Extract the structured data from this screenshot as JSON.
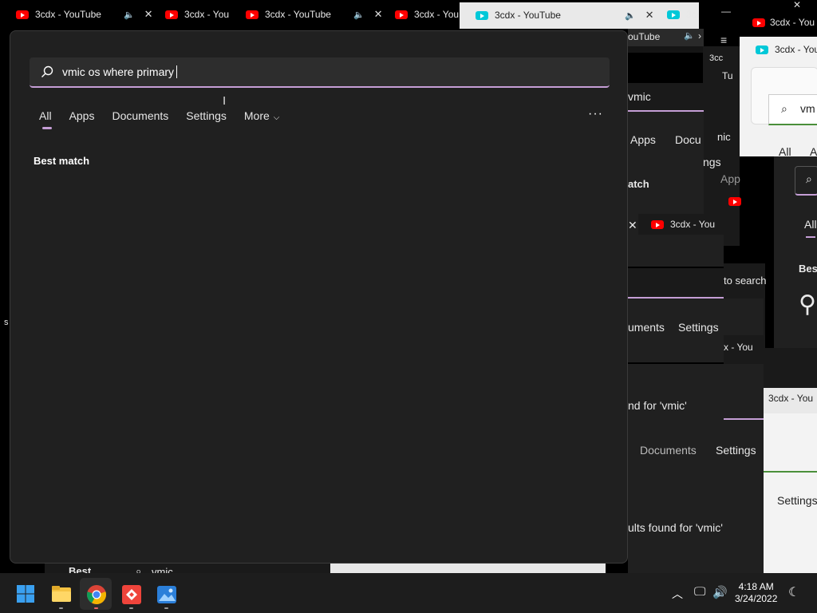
{
  "browser_tabs": [
    {
      "title": "3cdx - YouTube"
    },
    {
      "title": "3cdx - You"
    },
    {
      "title": "3cdx - YouTube"
    },
    {
      "title": "3cdx - You"
    },
    {
      "title": "3cdx - YouTube"
    },
    {
      "title": "3cc"
    }
  ],
  "ghost": {
    "top_tab_1": "3cdx - You",
    "top_tab_2": "3cdx - You",
    "yt_label": "ouTube",
    "tu_label": "3cc",
    "tu_label2": "Tu",
    "search_partial": "vmic",
    "search_partial_2": "vm",
    "apps": "Apps",
    "docu": "Docu",
    "ngs": "ngs",
    "all": "All",
    "a": "A",
    "app": "App",
    "atch": "atch",
    "best": "Best",
    "tab_3cdx": "3cdx - You",
    "to_search": "to search",
    "ube": "ube",
    "uments": "uments",
    "settings_1": "Settings",
    "x_you": "x - You",
    "tab_3cdx_2": "3cdx - You",
    "nd_for": "nd for 'vmic'",
    "documents": "Documents",
    "settings_2": "Settings",
    "settings_3": "Settings",
    "ults_found": "ults found for 'vmic'",
    "bottom_best": "Best",
    "bottom_search": "vmic",
    "left_s": "s",
    "vmic_suffix": "nic"
  },
  "search": {
    "query": "vmic os where primary"
  },
  "filters": [
    {
      "label": "All"
    },
    {
      "label": "Apps"
    },
    {
      "label": "Documents"
    },
    {
      "label": "Settings"
    },
    {
      "label": "More"
    }
  ],
  "more_options": "···",
  "results": {
    "best_match_heading": "Best match"
  },
  "clock": {
    "time": "4:18 AM",
    "date": "3/24/2022"
  },
  "taskbar": {
    "apps": [
      "start-icon",
      "file-explorer-icon",
      "chrome-icon",
      "anydesk-icon",
      "photos-icon"
    ]
  }
}
